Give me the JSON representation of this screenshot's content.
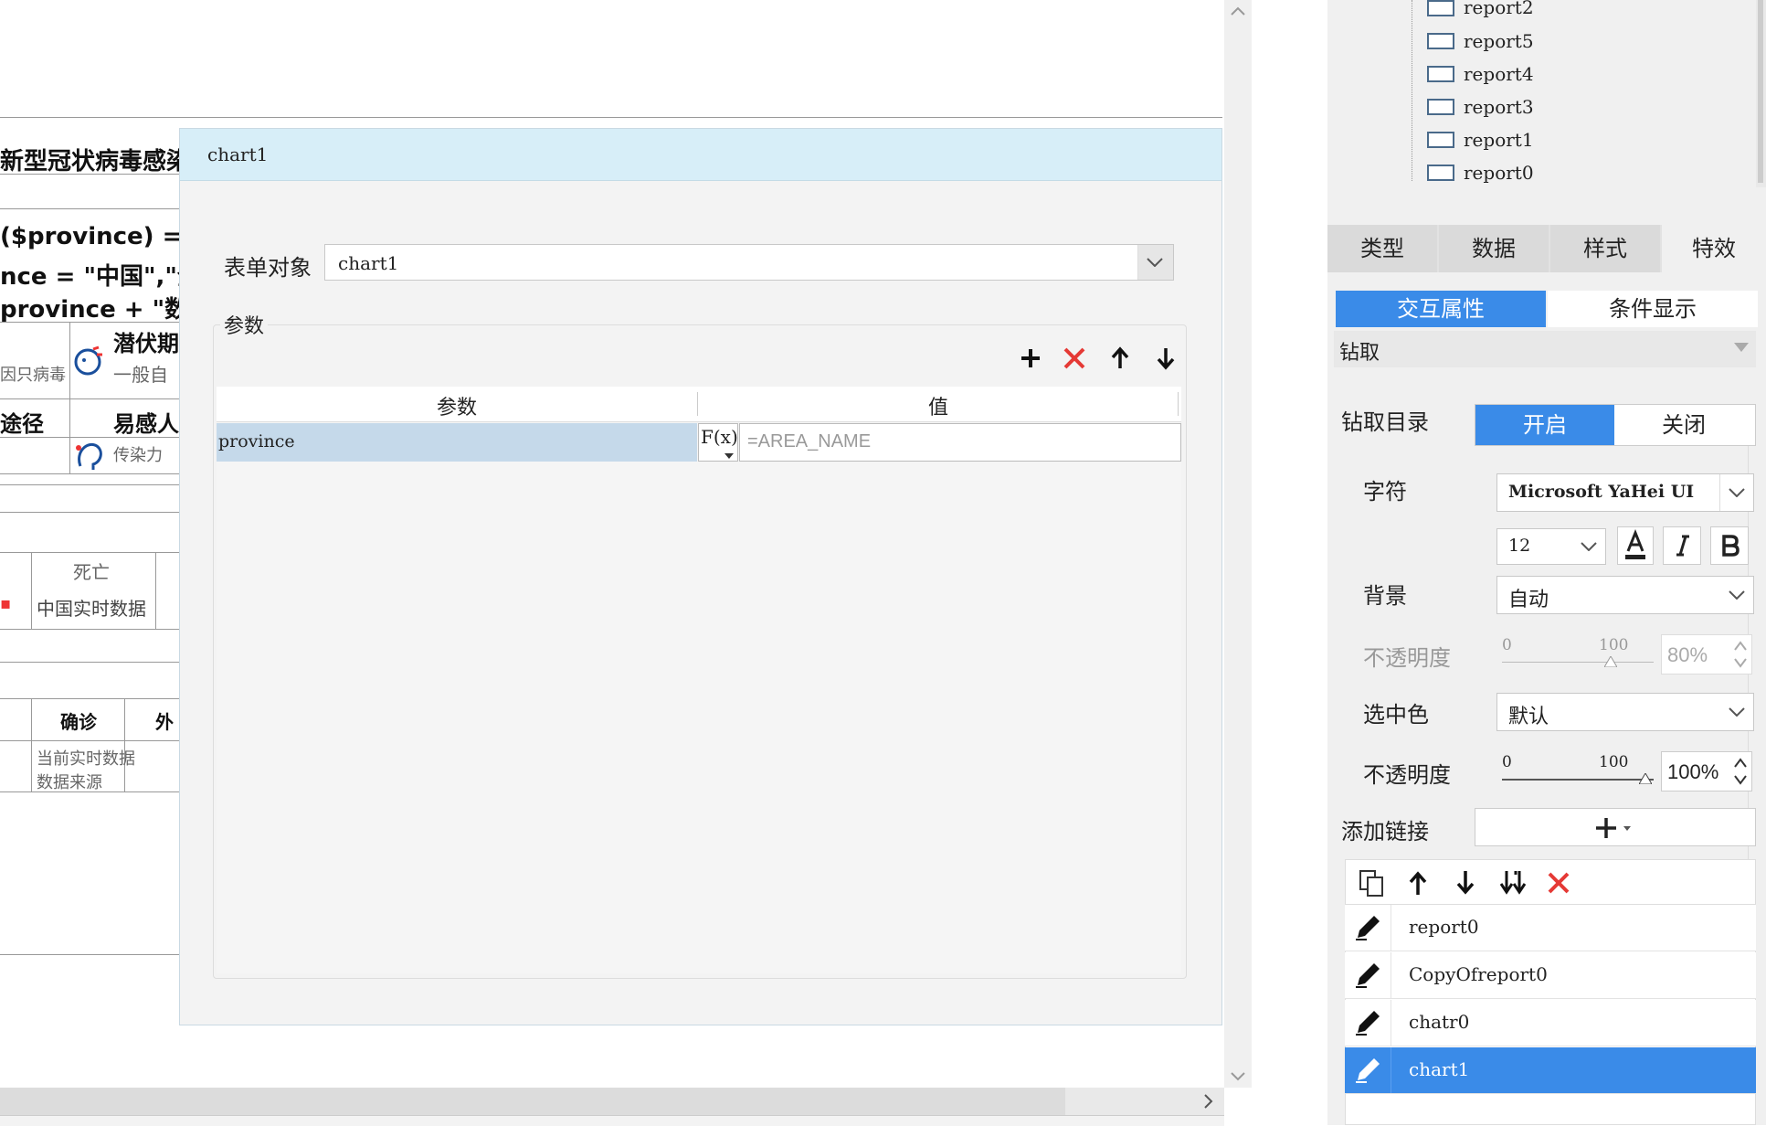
{
  "report": {
    "title_fragment": "新型冠状病毒感染",
    "formula_lines": [
      "($province) = (",
      "nce = \"中国\",\"全",
      "province + \"数"
    ],
    "labels": [
      "潜伏期",
      "一般自",
      "途径",
      "易感人",
      "死亡",
      "中国实时数据",
      "确诊",
      "外"
    ],
    "small_texts": [
      "因只病毒",
      "传染力",
      "当前实时数据",
      "数据来源"
    ]
  },
  "dialog": {
    "title": "chart1",
    "form_object_label": "表单对象",
    "form_object_value": "chart1",
    "params_group_label": "参数",
    "table": {
      "headers": [
        "参数",
        "值"
      ],
      "rows": [
        {
          "param": "province",
          "value": "=AREA_NAME"
        }
      ]
    },
    "fx_label": "F(x)"
  },
  "right_panel": {
    "tree_items": [
      "report2",
      "report5",
      "report4",
      "report3",
      "report1",
      "report0"
    ],
    "main_tabs": [
      "类型",
      "数据",
      "样式",
      "特效"
    ],
    "sub_tabs": [
      "交互属性",
      "条件显示"
    ],
    "section_title": "钻取",
    "drill_dir_label": "钻取目录",
    "drill_toggle": {
      "on": "开启",
      "off": "关闭"
    },
    "font_label": "字符",
    "font_value": "Microsoft YaHei UI",
    "font_size": "12",
    "bg_label": "背景",
    "bg_value": "自动",
    "opacity_label_disabled": "不透明度",
    "opacity1": {
      "min": "0",
      "max": "100",
      "value": "80%"
    },
    "select_color_label": "选中色",
    "select_color_value": "默认",
    "opacity_label": "不透明度",
    "opacity2": {
      "min": "0",
      "max": "100",
      "value": "100%"
    },
    "add_link_label": "添加链接",
    "links": [
      "report0",
      "CopyOfreport0",
      "chatr0",
      "chart1"
    ],
    "selected_link": "chart1"
  },
  "colors": {
    "accent": "#3a8be8",
    "dialog_header": "#d7eef8",
    "delete_red": "#e53935"
  }
}
